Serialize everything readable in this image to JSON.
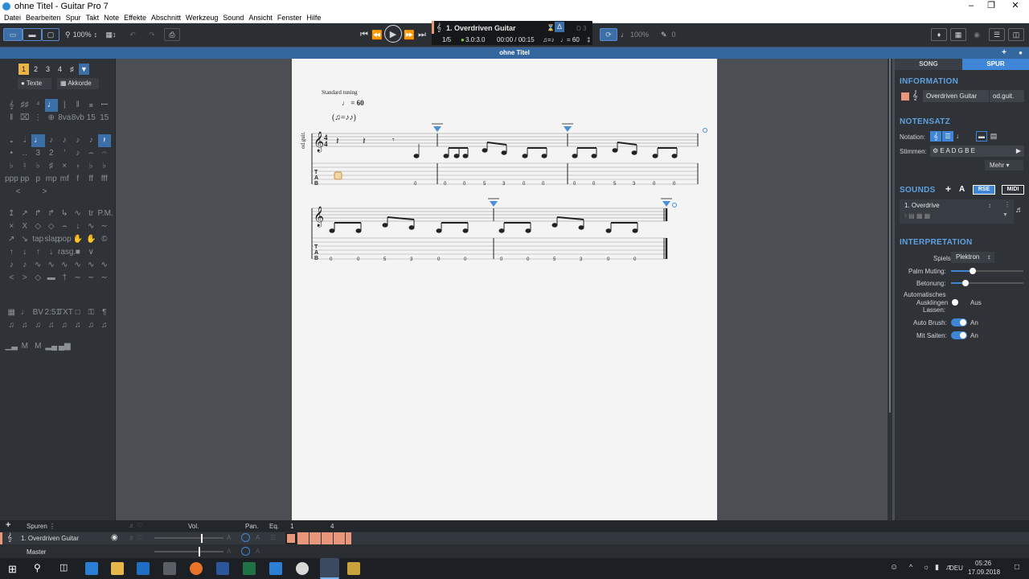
{
  "window": {
    "title": "ohne Titel - Guitar Pro 7"
  },
  "menu": [
    "Datei",
    "Bearbeiten",
    "Spur",
    "Takt",
    "Note",
    "Effekte",
    "Abschnitt",
    "Werkzeug",
    "Sound",
    "Ansicht",
    "Fenster",
    "Hilfe"
  ],
  "toolbar": {
    "zoom": "100%",
    "tempo_pct": "100%",
    "volume_val": "0"
  },
  "lcd": {
    "track_name": "1. Overdriven Guitar",
    "bar_pos": "1/5",
    "signature": "3.0:3.0",
    "time": "00:00 / 00:15",
    "tempo": "= 60",
    "key": "D 3"
  },
  "document": {
    "title": "ohne Titel"
  },
  "left_panel": {
    "voices": [
      "1",
      "2",
      "3",
      "4"
    ],
    "texts_label": "Texte",
    "chords_label": "Akkorde"
  },
  "score": {
    "tuning": "Standard tuning",
    "tempo": "= 60",
    "track_abbr": "od.guit.",
    "tab_numbers_line1": [
      "0",
      "0",
      "0",
      "5",
      "3",
      "0",
      "0",
      "0",
      "0",
      "5",
      "3",
      "0",
      "0"
    ],
    "tab_numbers_line2": [
      "0",
      "0",
      "5",
      "3",
      "0",
      "0",
      "0",
      "0",
      "5",
      "3",
      "0",
      "0"
    ]
  },
  "right_panel": {
    "tab_song": "SONG",
    "tab_spur": "SPUR",
    "information_title": "INFORMATION",
    "track_name": "Overdriven Guitar",
    "track_short": "od.guit.",
    "notation_title": "NOTENSATZ",
    "notation_label": "Notation:",
    "voices_label": "Stimmen:",
    "tuning": "E A D G B E",
    "more_label": "Mehr",
    "sounds_title": "SOUNDS",
    "rse_label": "RSE",
    "midi_label": "MIDI",
    "sound_name": "1. Overdrive",
    "interpretation_title": "INTERPRETATION",
    "style_label": "Spielstil:",
    "style_value": "Plektron",
    "palm_label": "Palm Muting:",
    "palm_value": 0.3,
    "accent_label": "Betonung:",
    "accent_value": 0.2,
    "auto_ring_label_1": "Automatisches",
    "auto_ring_label_2": "Ausklingen",
    "auto_ring_label_3": "Lassen:",
    "auto_ring_value": "Aus",
    "auto_brush_label": "Auto Brush:",
    "auto_brush_value": "An",
    "strings_label": "Mit Saiten:",
    "strings_value": "An"
  },
  "tracks_panel": {
    "header": "Spuren",
    "vol_label": "Vol.",
    "pan_label": "Pan.",
    "eq_label": "Eq.",
    "bar_1": "1",
    "bar_4": "4",
    "track_name": "1. Overdriven Guitar",
    "master_label": "Master",
    "track_color": "#e9967a"
  },
  "taskbar": {
    "lang": "DEU",
    "time": "05:26",
    "date": "17.09.2018"
  }
}
